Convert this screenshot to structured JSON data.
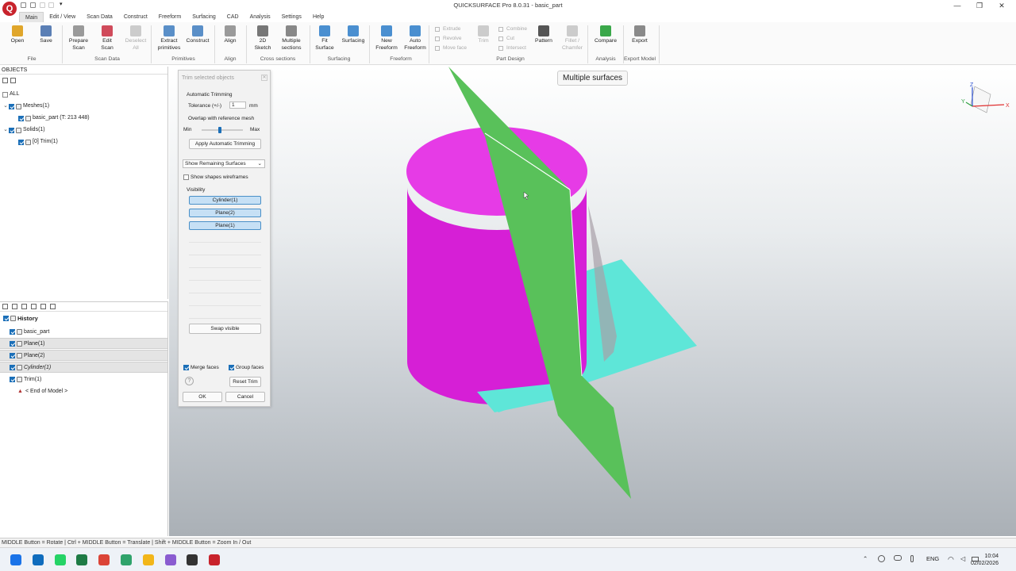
{
  "window": {
    "title": "QUICKSURFACE Pro 8.0.31 - basic_part",
    "minimize": "—",
    "maximize": "❐",
    "close": "✕"
  },
  "app_logo": "Q",
  "menu": [
    "Main",
    "Edit / View",
    "Scan Data",
    "Construct",
    "Freeform",
    "Surfacing",
    "CAD",
    "Analysis",
    "Settings",
    "Help"
  ],
  "ribbon": {
    "buttons": [
      {
        "label": "Open",
        "icon": "folder-icon",
        "color": "#e0a62b"
      },
      {
        "label": "Save",
        "icon": "save-icon",
        "color": "#5b7fb5"
      },
      {
        "label": "Prepare\nScan",
        "icon": "prepare-scan-icon",
        "color": "#9a9a9a"
      },
      {
        "label": "Edit\nScan",
        "icon": "edit-scan-icon",
        "color": "#d04b5b"
      },
      {
        "label": "Deselect\nAll",
        "icon": "deselect-icon",
        "color": "#cccccc",
        "disabled": true
      },
      {
        "label": "Extract\nprimitives",
        "icon": "extract-primitives-icon",
        "color": "#5a8fc8"
      },
      {
        "label": "Construct",
        "icon": "construct-icon",
        "color": "#5a8fc8"
      },
      {
        "label": "Align",
        "icon": "align-icon",
        "color": "#9a9a9a"
      },
      {
        "label": "2D\nSketch",
        "icon": "sketch-icon",
        "color": "#777777"
      },
      {
        "label": "Multiple\nsections",
        "icon": "sections-icon",
        "color": "#888888"
      },
      {
        "label": "Fit\nSurface",
        "icon": "fit-surface-icon",
        "color": "#4a8fd0"
      },
      {
        "label": "Surfacing",
        "icon": "surfacing-icon",
        "color": "#4a8fd0"
      },
      {
        "label": "New\nFreeform",
        "icon": "new-freeform-icon",
        "color": "#4a8fd0"
      },
      {
        "label": "Auto\nFreeform",
        "icon": "auto-freeform-icon",
        "color": "#4a8fd0"
      },
      {
        "label": "Trim",
        "icon": "trim-icon",
        "color": "#cccccc",
        "disabled": true
      },
      {
        "label": "Pattern",
        "icon": "pattern-icon",
        "color": "#555555"
      },
      {
        "label": "Fillet /\nChamfer",
        "icon": "fillet-icon",
        "color": "#cccccc",
        "disabled": true
      },
      {
        "label": "Compare",
        "icon": "compare-icon",
        "color": "#3aa84a"
      },
      {
        "label": "Export",
        "icon": "export-icon",
        "color": "#8a8a8a"
      }
    ],
    "small_buttons": [
      "Extrude",
      "Revolve",
      "Move face",
      "Combine",
      "Cut",
      "Intersect"
    ],
    "groups": [
      "File",
      "Scan Data",
      "Primitives",
      "Align",
      "Cross sections",
      "Surfacing",
      "Freeform",
      "Part Design",
      "Analysis",
      "Export Model"
    ]
  },
  "objects_panel": {
    "header": "OBJECTS",
    "items": [
      {
        "label": "ALL",
        "level": 0,
        "checked": false
      },
      {
        "label": "Meshes(1)",
        "level": 0,
        "checked": true,
        "expanded": true
      },
      {
        "label": "basic_part (T: 213 448)",
        "level": 1,
        "checked": true
      },
      {
        "label": "Solids(1)",
        "level": 0,
        "checked": true,
        "expanded": true
      },
      {
        "label": "[0] Trim(1)",
        "level": 1,
        "checked": true
      }
    ]
  },
  "history_panel": {
    "header": "History",
    "items": [
      {
        "label": "basic_part",
        "selected": false,
        "italic": false
      },
      {
        "label": "Plane(1)",
        "selected": true,
        "italic": false
      },
      {
        "label": "Plane(2)",
        "selected": true,
        "italic": false
      },
      {
        "label": "Cylinder(1)",
        "selected": true,
        "italic": true
      },
      {
        "label": "Trim(1)",
        "selected": false,
        "italic": false
      },
      {
        "label": "< End of Model >",
        "selected": false,
        "italic": false
      }
    ]
  },
  "dialog": {
    "title": "Trim selected objects",
    "auto_trimming": "Automatic Trimming",
    "tolerance_label": "Tolerance (+/-)",
    "tolerance_value": "1",
    "tolerance_unit": "mm",
    "overlap_label": "Overlap with reference mesh",
    "min_label": "Min",
    "max_label": "Max",
    "overlap_level": 0.45,
    "apply_button": "Apply Automatic Trimming",
    "show_select": "Show Remaining Surfaces",
    "wireframes_label": "Show shapes wireframes",
    "wireframes_checked": false,
    "visibility_label": "Visibility",
    "visibility_items": [
      "Cylinder(1)",
      "Plane(2)",
      "Plane(1)"
    ],
    "swap_button": "Swap visible",
    "merge_faces": "Merge faces",
    "group_faces": "Group faces",
    "help": "?",
    "reset_button": "Reset Trim",
    "ok_button": "OK",
    "cancel_button": "Cancel"
  },
  "viewport": {
    "badge": "Multiple surfaces",
    "colors": {
      "cylinder": "#d61fd6",
      "cylinder_top": "#e63be6",
      "plane_green": "#59c15a",
      "plane_cyan": "#5ee6d8"
    },
    "axes": {
      "x": "X",
      "y": "Y",
      "z": "Z"
    }
  },
  "status_bar": "MIDDLE Button = Rotate | Ctrl + MIDDLE Button = Translate | Shift + MIDDLE Button = Zoom In / Out",
  "taskbar": {
    "apps": [
      {
        "name": "windows-start-icon",
        "color": "#1a73e8"
      },
      {
        "name": "outlook-icon",
        "color": "#0f6cbd"
      },
      {
        "name": "whatsapp-icon",
        "color": "#25d366"
      },
      {
        "name": "excel-icon",
        "color": "#1e7b45"
      },
      {
        "name": "chrome-icon",
        "color": "#db4437"
      },
      {
        "name": "camtasia-icon",
        "color": "#2fa36b"
      },
      {
        "name": "file-explorer-icon",
        "color": "#f2b619"
      },
      {
        "name": "visual-studio-icon",
        "color": "#8a5cd0"
      },
      {
        "name": "davinci-icon",
        "color": "#333333"
      },
      {
        "name": "quicksurface-icon",
        "color": "#c8232c"
      }
    ],
    "language": "ENG",
    "time": "10:04",
    "date": "02/02/2026"
  }
}
